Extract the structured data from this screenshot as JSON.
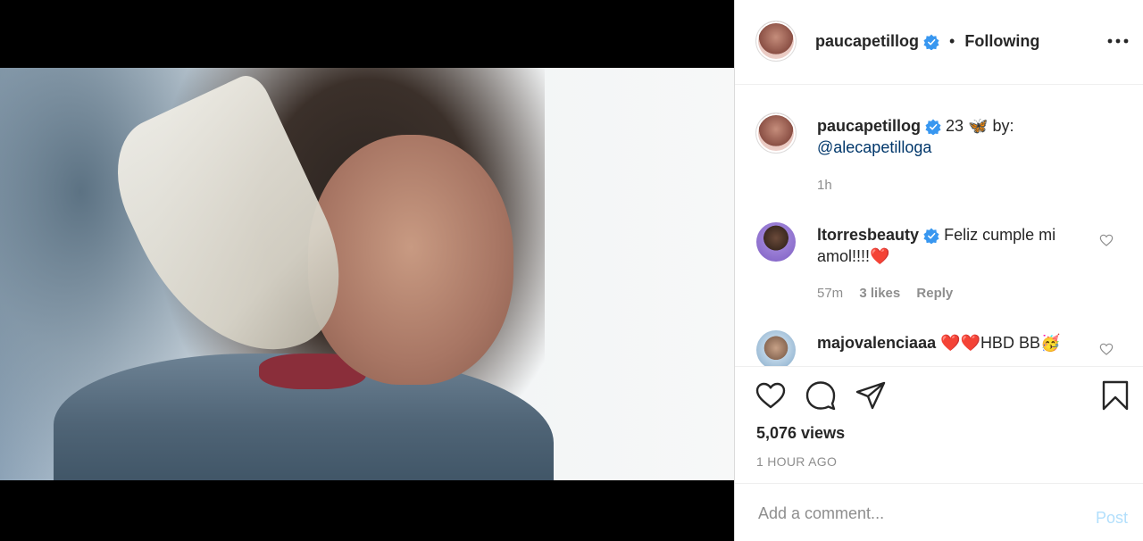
{
  "header": {
    "username": "paucapetillog",
    "separator": "•",
    "following_label": "Following",
    "more_icon": "more-horizontal-icon"
  },
  "caption": {
    "username": "paucapetillog",
    "text": "23",
    "emoji": "🦋",
    "by_text": "by:",
    "mention": "@alecapetilloga",
    "time": "1h"
  },
  "comments": [
    {
      "username": "ltorresbeauty",
      "text": "Feliz cumple mi amol!!!!",
      "emoji": "❤️",
      "time": "57m",
      "likes": "3 likes",
      "reply_label": "Reply"
    },
    {
      "username": "majovalenciaaa",
      "hearts": "❤️❤️",
      "text": "HBD BB",
      "emoji": "🥳"
    }
  ],
  "actions": {
    "views": "5,076 views",
    "timestamp": "1 HOUR AGO"
  },
  "composer": {
    "placeholder": "Add a comment...",
    "post_label": "Post"
  },
  "colors": {
    "verified": "#3897f0",
    "link": "#00376b",
    "post_disabled": "#b2dffc",
    "muted": "#8e8e8e"
  }
}
